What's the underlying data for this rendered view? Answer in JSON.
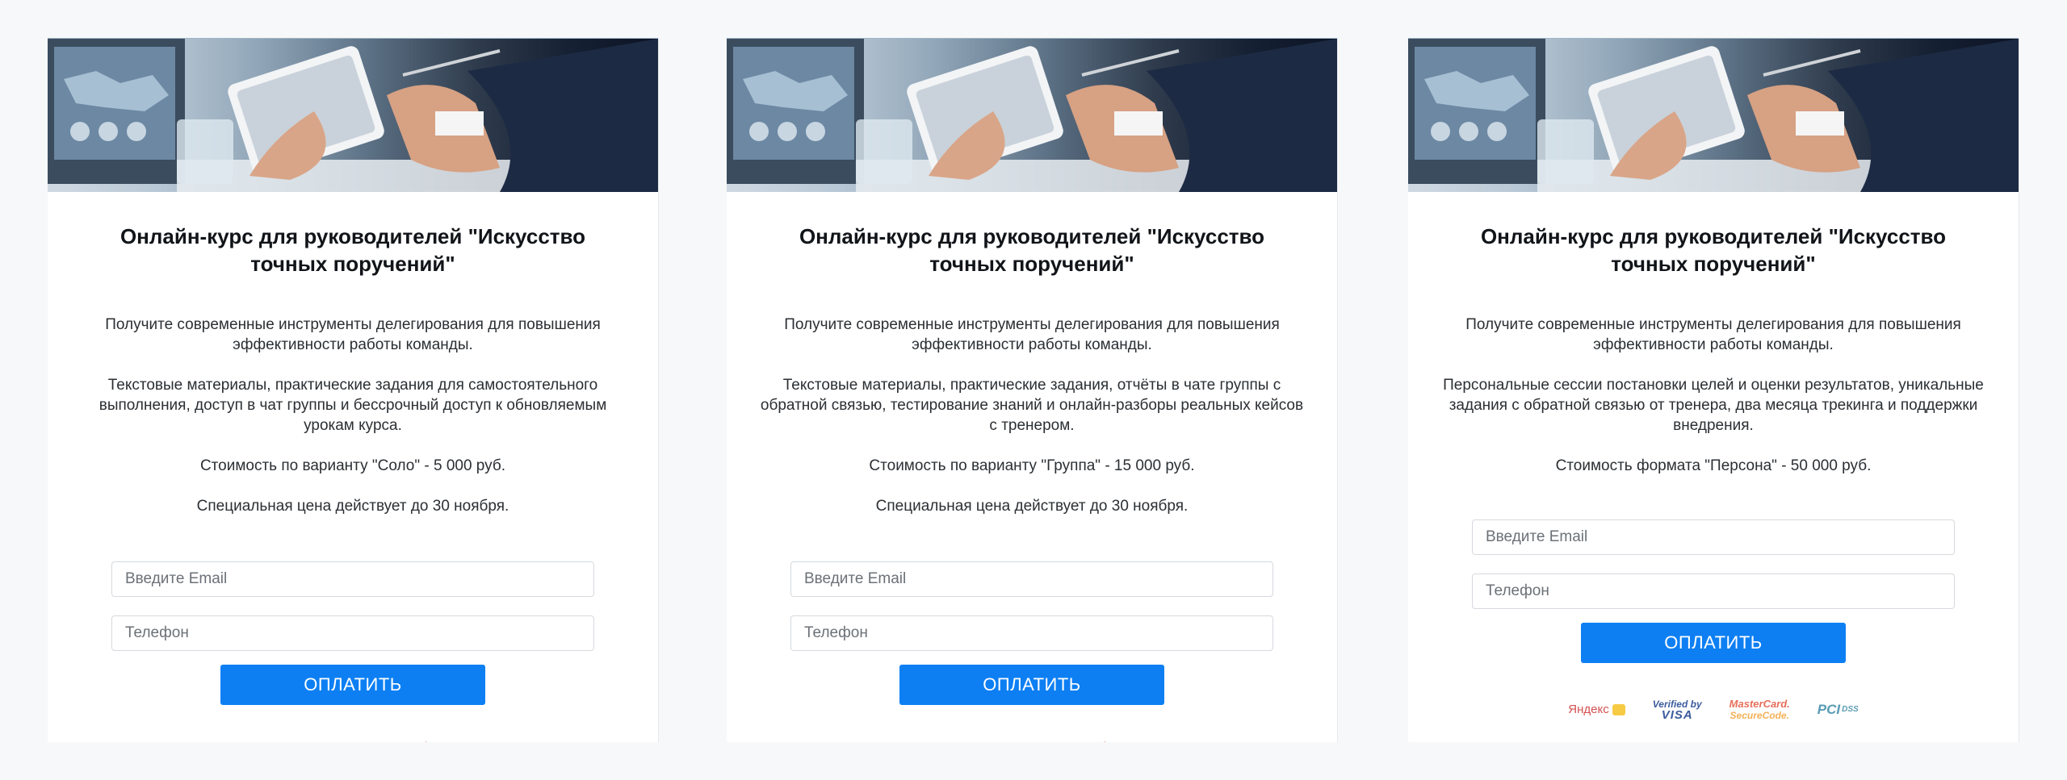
{
  "cards": [
    {
      "title": "Онлайн-курс для руководителей \"Искусство точных поручений\"",
      "intro": "Получите современные инструменты делегирования для повышения эффективности работы команды.",
      "features": "Текстовые материалы, практические задания для самостоятельного выполнения, доступ в чат группы и бессрочный доступ к обновляемым урокам курса.",
      "price": "Стоимость по варианту \"Соло\" - 5 000 руб.",
      "deadline": "Специальная цена действует до 30 ноября.",
      "email_placeholder": "Введите Email",
      "phone_placeholder": "Телефон",
      "button_label": "ОПЛАТИТЬ"
    },
    {
      "title": "Онлайн-курс для руководителей \"Искусство точных поручений\"",
      "intro": "Получите современные инструменты делегирования для повышения эффективности работы команды.",
      "features": "Текстовые материалы, практические задания, отчёты в чате группы с обратной связью, тестирование знаний и онлайн-разборы реальных кейсов с тренером.",
      "price": "Стоимость по варианту \"Группа\" - 15 000 руб.",
      "deadline": "Специальная цена действует до 30 ноября.",
      "email_placeholder": "Введите Email",
      "phone_placeholder": "Телефон",
      "button_label": "ОПЛАТИТЬ"
    },
    {
      "title": "Онлайн-курс для руководителей \"Искусство точных поручений\"",
      "intro": "Получите современные инструменты делегирования для повышения эффективности работы команды.",
      "features": "Персональные сессии постановки целей и оценки результатов, уникальные задания с обратной связью от тренера, два месяца трекинга и поддержки внедрения.",
      "price": "Стоимость формата \"Персона\" - 50 000 руб.",
      "email_placeholder": "Введите Email",
      "phone_placeholder": "Телефон",
      "button_label": "ОПЛАТИТЬ"
    }
  ],
  "payment_logos": {
    "yandex": "Яндекс",
    "visa_top": "Verified by",
    "visa_bottom": "VISA",
    "mastercard_top": "MasterCard.",
    "mastercard_bottom": "SecureCode.",
    "pci": "PCI",
    "pci_dss": "DSS"
  },
  "colors": {
    "button": "#0d7ff3",
    "page_background": "#f7f8f9"
  },
  "icons": [
    "yandex-money-logo",
    "verified-by-visa-logo",
    "mastercard-securecode-logo",
    "pci-dss-logo"
  ]
}
